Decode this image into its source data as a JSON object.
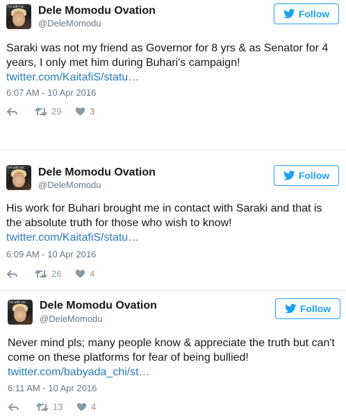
{
  "tweets": [
    {
      "author_name": "Dele Momodu Ovation",
      "handle": "@DeleMomodu",
      "follow_label": "Follow",
      "avatar_caption": "I'm with her.",
      "text_line1": "Saraki was not my friend as Governor for 8 yrs & as Senator for 4",
      "text_line2": "years, I only met him during Buhari's campaign!",
      "link": "twitter.com/KaitafiS/statu…",
      "timestamp": "6:07 AM - 10 Apr 2016",
      "retweets": "29",
      "likes": "3"
    },
    {
      "author_name": "Dele Momodu Ovation",
      "handle": "@DeleMomodu",
      "follow_label": "Follow",
      "avatar_caption": "I'm with her.",
      "text_line1": "His work for Buhari brought me in contact with Saraki and that is",
      "text_line2": "the absolute truth for those who wish to know!",
      "link": "twitter.com/KaitafiS/statu…",
      "timestamp": "6:09 AM - 10 Apr 2016",
      "retweets": "26",
      "likes": "4"
    },
    {
      "author_name": "Dele Momodu Ovation",
      "handle": "@DeleMomodu",
      "follow_label": "Follow",
      "avatar_caption": "I'm with her.",
      "text_line1": "Never mind pls; many people know & appreciate the truth but can't",
      "text_line2": "come on these platforms for fear of being bullied!",
      "link": "twitter.com/babyada_chi/st…",
      "timestamp": "6:11 AM - 10 Apr 2016",
      "retweets": "13",
      "likes": "4"
    }
  ],
  "colors": {
    "twitter_blue": "#1da1f2",
    "link_blue": "#2b7bb9",
    "meta_gray": "#657786",
    "icon_gray": "#8899a6"
  },
  "icons": {
    "reply": "reply-icon",
    "retweet": "retweet-icon",
    "like": "heart-icon",
    "follow": "twitter-bird-icon"
  }
}
